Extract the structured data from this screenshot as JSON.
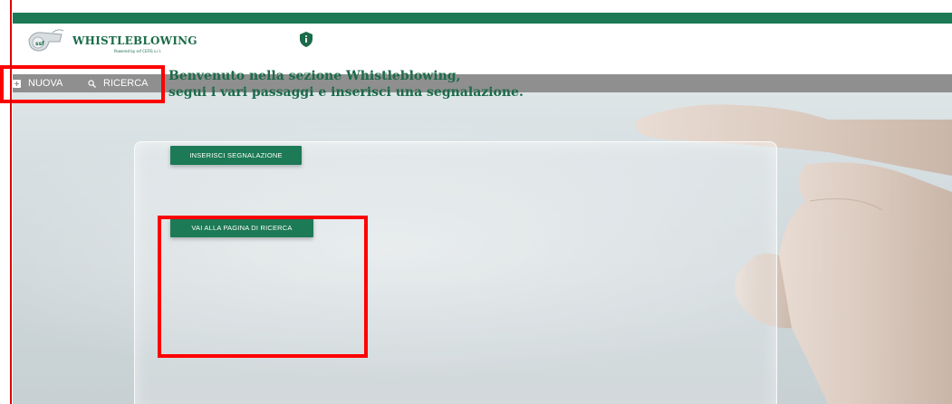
{
  "app": {
    "logo_text": "WHISTLEBLOWING",
    "logo_subtext": "Powered by ssf CEFIS s.r.l.",
    "logo_icon": "whistle-icon",
    "info_icon": "shield-info-icon"
  },
  "colors": {
    "brand_green": "#1b7a55",
    "nav_gray": "#8f8f8f",
    "highlight_red": "#ff0000"
  },
  "nav": {
    "items": [
      {
        "label": "NUOVA",
        "icon": "plus-square-icon"
      },
      {
        "label": "RICERCA",
        "icon": "search-icon"
      }
    ]
  },
  "main": {
    "welcome_line1": "Benvenuto nella sezione Whistleblowing,",
    "welcome_line2": "segui i vari passaggi e inserisci una segnalazione.",
    "buttons": {
      "insert": "INSERISCI SEGNALAZIONE",
      "search": "VAI ALLA PAGINA DI RICERCA"
    }
  }
}
